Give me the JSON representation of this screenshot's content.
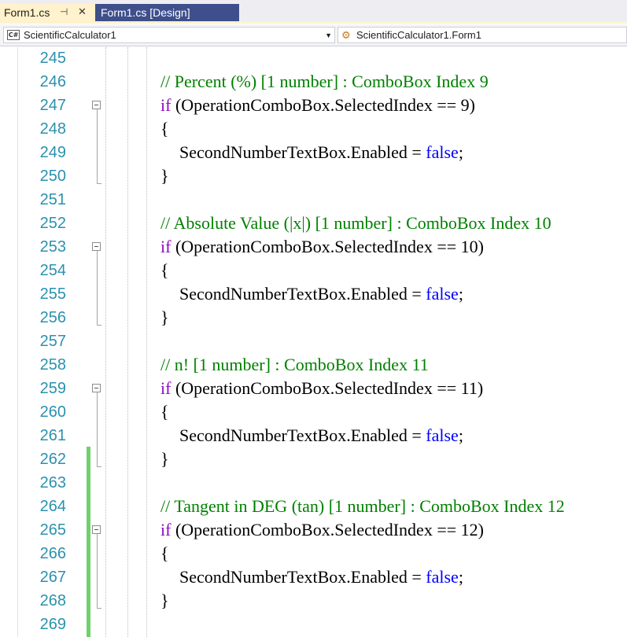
{
  "tabs": [
    {
      "label": "Form1.cs",
      "active": true
    },
    {
      "label": "Form1.cs [Design]",
      "active": false
    }
  ],
  "tab_icons": {
    "pin": "⊣",
    "close": "✕"
  },
  "navbar": {
    "project": "ScientificCalculator1",
    "class_member": "ScientificCalculator1.Form1",
    "project_badge": "C#"
  },
  "colors": {
    "line_number": "#2b91af",
    "comment": "#008000",
    "keyword_control": "#8f08c4",
    "keyword": "#0000ff",
    "change_bar": "#6fd16a"
  },
  "lines": [
    {
      "n": "245",
      "tokens": []
    },
    {
      "n": "246",
      "indent": 2,
      "tokens": [
        {
          "t": "// Percent (%) [1 number] : ComboBox Index 9",
          "c": "comment"
        }
      ]
    },
    {
      "n": "247",
      "indent": 2,
      "collapse": true,
      "tokens": [
        {
          "t": "if",
          "c": "keyword"
        },
        {
          "t": " (OperationComboBox.SelectedIndex == 9)",
          "c": ""
        }
      ]
    },
    {
      "n": "248",
      "indent": 2,
      "tokens": [
        {
          "t": "{",
          "c": ""
        }
      ]
    },
    {
      "n": "249",
      "indent": 3,
      "tokens": [
        {
          "t": "SecondNumberTextBox.Enabled = ",
          "c": ""
        },
        {
          "t": "false",
          "c": "kwblue"
        },
        {
          "t": ";",
          "c": ""
        }
      ]
    },
    {
      "n": "250",
      "indent": 2,
      "tokens": [
        {
          "t": "}",
          "c": ""
        }
      ]
    },
    {
      "n": "251",
      "tokens": []
    },
    {
      "n": "252",
      "indent": 2,
      "tokens": [
        {
          "t": "// Absolute Value (|x|) [1 number] : ComboBox Index 10",
          "c": "comment"
        }
      ]
    },
    {
      "n": "253",
      "indent": 2,
      "collapse": true,
      "tokens": [
        {
          "t": "if",
          "c": "keyword"
        },
        {
          "t": " (OperationComboBox.SelectedIndex == 10)",
          "c": ""
        }
      ]
    },
    {
      "n": "254",
      "indent": 2,
      "tokens": [
        {
          "t": "{",
          "c": ""
        }
      ]
    },
    {
      "n": "255",
      "indent": 3,
      "tokens": [
        {
          "t": "SecondNumberTextBox.Enabled = ",
          "c": ""
        },
        {
          "t": "false",
          "c": "kwblue"
        },
        {
          "t": ";",
          "c": ""
        }
      ]
    },
    {
      "n": "256",
      "indent": 2,
      "tokens": [
        {
          "t": "}",
          "c": ""
        }
      ]
    },
    {
      "n": "257",
      "tokens": []
    },
    {
      "n": "258",
      "indent": 2,
      "tokens": [
        {
          "t": "// n! [1 number] : ComboBox Index 11",
          "c": "comment"
        }
      ]
    },
    {
      "n": "259",
      "indent": 2,
      "collapse": true,
      "tokens": [
        {
          "t": "if",
          "c": "keyword"
        },
        {
          "t": " (OperationComboBox.SelectedIndex == 11)",
          "c": ""
        }
      ]
    },
    {
      "n": "260",
      "indent": 2,
      "tokens": [
        {
          "t": "{",
          "c": ""
        }
      ]
    },
    {
      "n": "261",
      "indent": 3,
      "tokens": [
        {
          "t": "SecondNumberTextBox.Enabled = ",
          "c": ""
        },
        {
          "t": "false",
          "c": "kwblue"
        },
        {
          "t": ";",
          "c": ""
        }
      ]
    },
    {
      "n": "262",
      "indent": 2,
      "tokens": [
        {
          "t": "}",
          "c": ""
        }
      ]
    },
    {
      "n": "263",
      "tokens": []
    },
    {
      "n": "264",
      "indent": 2,
      "tokens": [
        {
          "t": "// Tangent in DEG (tan) [1 number] : ComboBox Index 12",
          "c": "comment"
        }
      ]
    },
    {
      "n": "265",
      "indent": 2,
      "collapse": true,
      "tokens": [
        {
          "t": "if",
          "c": "keyword"
        },
        {
          "t": " (OperationComboBox.SelectedIndex == 12)",
          "c": ""
        }
      ]
    },
    {
      "n": "266",
      "indent": 2,
      "tokens": [
        {
          "t": "{",
          "c": ""
        }
      ]
    },
    {
      "n": "267",
      "indent": 3,
      "tokens": [
        {
          "t": "SecondNumberTextBox.Enabled = ",
          "c": ""
        },
        {
          "t": "false",
          "c": "kwblue"
        },
        {
          "t": ";",
          "c": ""
        }
      ]
    },
    {
      "n": "268",
      "indent": 2,
      "tokens": [
        {
          "t": "}",
          "c": ""
        }
      ]
    },
    {
      "n": "269",
      "tokens": []
    }
  ]
}
